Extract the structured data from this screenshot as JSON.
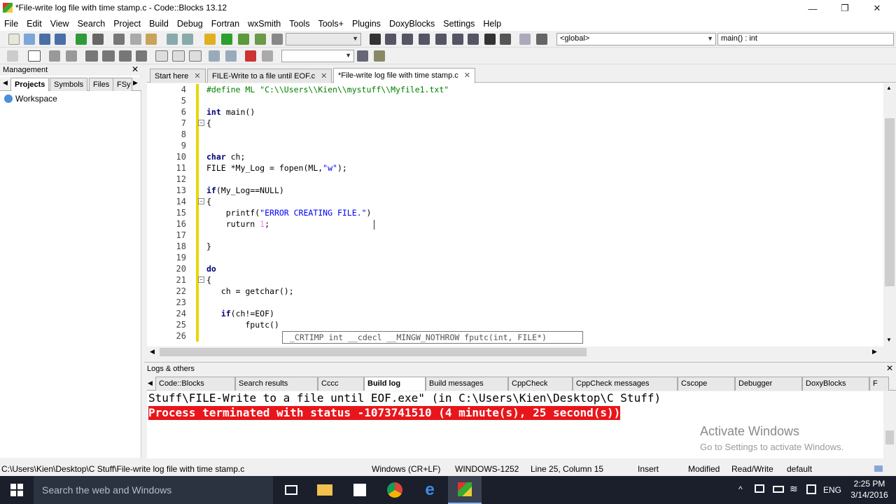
{
  "window": {
    "title": "*File-write log file with time stamp.c - Code::Blocks 13.12",
    "minimize": "—",
    "maximize": "❐",
    "close": "✕"
  },
  "menu": [
    "File",
    "Edit",
    "View",
    "Search",
    "Project",
    "Build",
    "Debug",
    "Fortran",
    "wxSmith",
    "Tools",
    "Tools+",
    "Plugins",
    "DoxyBlocks",
    "Settings",
    "Help"
  ],
  "toolbar": {
    "scope_value": "<global>",
    "function_value": "main() : int"
  },
  "management": {
    "title": "Management",
    "tabs": [
      "Projects",
      "Symbols",
      "Files",
      "FSy"
    ],
    "tree_root": "Workspace"
  },
  "editor_tabs": [
    {
      "label": "Start here",
      "active": false
    },
    {
      "label": "FILE-Write to a file until EOF.c",
      "active": false
    },
    {
      "label": "*File-write log file with time stamp.c",
      "active": true
    }
  ],
  "code_lines": [
    {
      "n": "4",
      "text": "#define ML \"C:\\\\Users\\\\Kien\\\\mystuff\\\\Myfile1.txt\""
    },
    {
      "n": "5",
      "text": ""
    },
    {
      "n": "6",
      "text": "int main()"
    },
    {
      "n": "7",
      "text": "{"
    },
    {
      "n": "8",
      "text": ""
    },
    {
      "n": "9",
      "text": ""
    },
    {
      "n": "10",
      "text": "char ch;"
    },
    {
      "n": "11",
      "text": "FILE *My_Log = fopen(ML,\"w\");"
    },
    {
      "n": "12",
      "text": ""
    },
    {
      "n": "13",
      "text": "if(My_Log==NULL)"
    },
    {
      "n": "14",
      "text": "{"
    },
    {
      "n": "15",
      "text": "    printf(\"ERROR CREATING FILE.\")"
    },
    {
      "n": "16",
      "text": "    ruturn 1;"
    },
    {
      "n": "17",
      "text": ""
    },
    {
      "n": "18",
      "text": "}"
    },
    {
      "n": "19",
      "text": ""
    },
    {
      "n": "20",
      "text": "do"
    },
    {
      "n": "21",
      "text": "{"
    },
    {
      "n": "22",
      "text": "   ch = getchar();"
    },
    {
      "n": "23",
      "text": ""
    },
    {
      "n": "24",
      "text": "   if(ch!=EOF)"
    },
    {
      "n": "25",
      "text": "        fputc()"
    },
    {
      "n": "26",
      "text": ""
    }
  ],
  "tooltip": "_CRTIMP int __cdecl __MINGW_NOTHROW fputc(int, FILE*)",
  "logs": {
    "title": "Logs & others",
    "tabs": [
      "Code::Blocks",
      "Search results",
      "Cccc",
      "Build log",
      "Build messages",
      "CppCheck",
      "CppCheck messages",
      "Cscope",
      "Debugger",
      "DoxyBlocks",
      "F"
    ],
    "active_tab": "Build log",
    "lines": [
      "Stuff\\FILE-Write to a file until EOF.exe\" (in C:\\Users\\Kien\\Desktop\\C Stuff)",
      "Process terminated with status -1073741510 (4 minute(s), 25 second(s))"
    ],
    "watermark_title": "Activate Windows",
    "watermark_sub": "Go to Settings to activate Windows."
  },
  "status": {
    "path": "C:\\Users\\Kien\\Desktop\\C Stuff\\File-write log file with time stamp.c",
    "eol": "Windows (CR+LF)",
    "encoding": "WINDOWS-1252",
    "position": "Line 25, Column 15",
    "mode": "Insert",
    "modified": "Modified",
    "access": "Read/Write",
    "profile": "default"
  },
  "taskbar": {
    "search_placeholder": "Search the web and Windows",
    "lang": "ENG",
    "time": "2:25 PM",
    "date": "3/14/2016"
  },
  "colors": {
    "error_bg": "#e8161b",
    "keyword": "#00007a",
    "string": "#0000ff",
    "preprocessor": "#008000",
    "taskbar": "#1a1f2b"
  }
}
